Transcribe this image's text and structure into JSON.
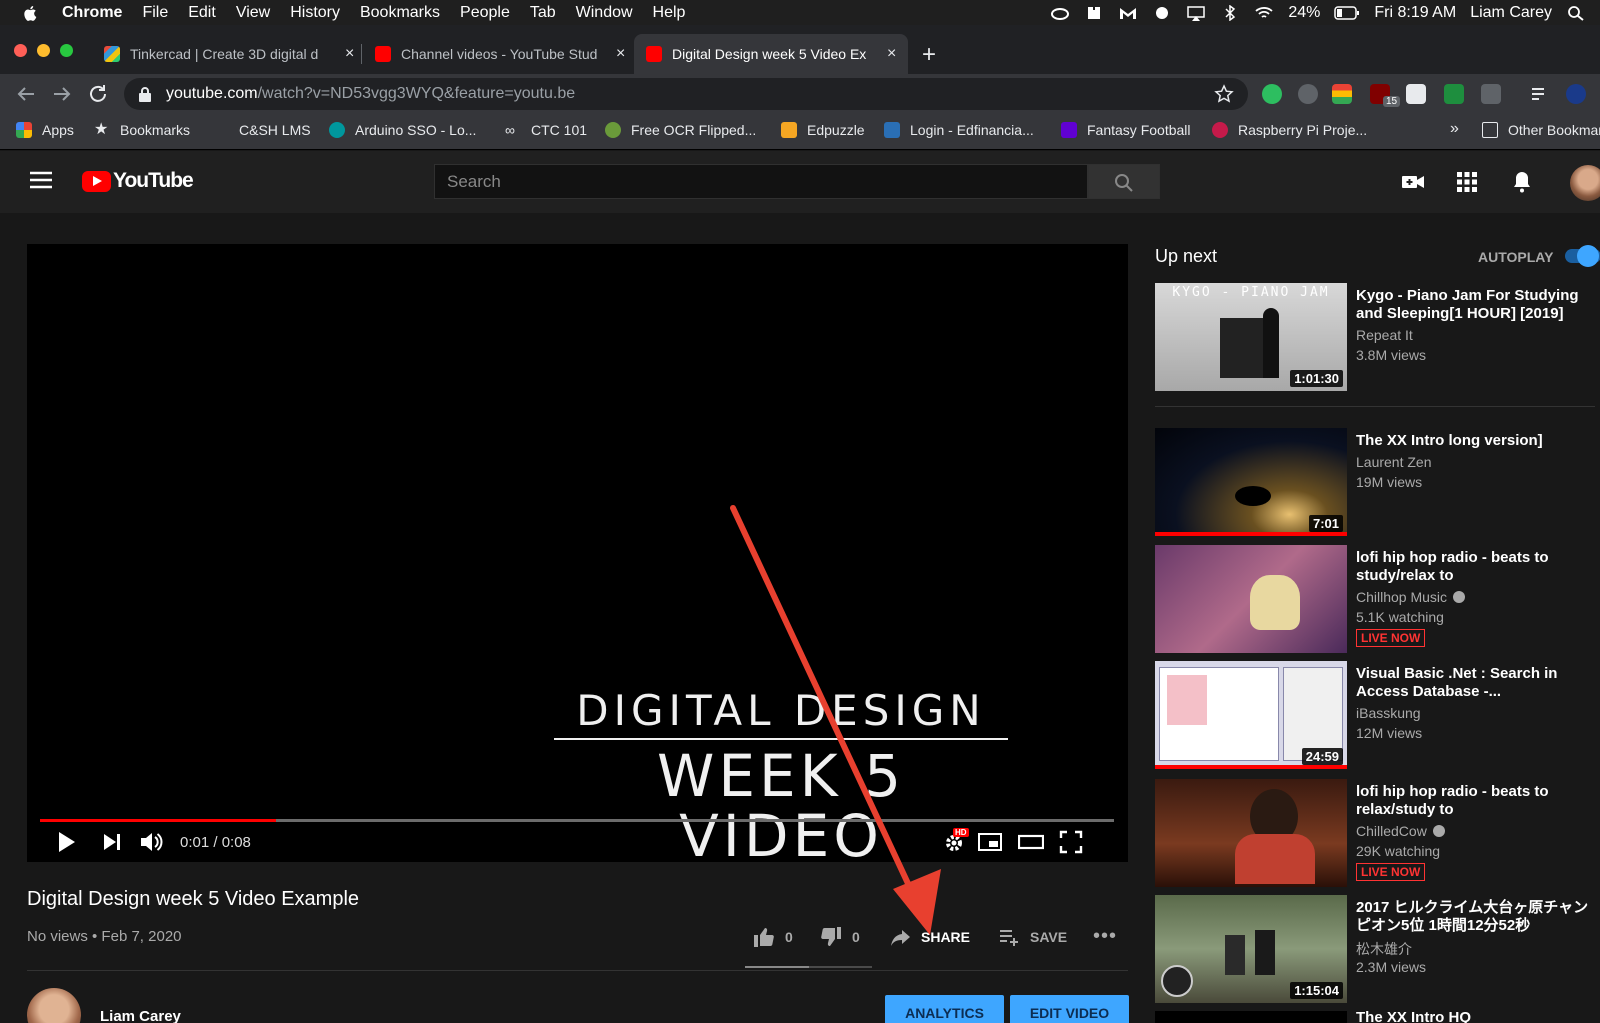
{
  "menubar": {
    "app": "Chrome",
    "items": [
      "File",
      "Edit",
      "View",
      "History",
      "Bookmarks",
      "People",
      "Tab",
      "Window",
      "Help"
    ],
    "battery": "24%",
    "clock": "Fri 8:19 AM",
    "user": "Liam Carey"
  },
  "tabs": [
    {
      "title": "Tinkercad | Create 3D digital d",
      "close": "×"
    },
    {
      "title": "Channel videos - YouTube Stud",
      "close": "×"
    },
    {
      "title": "Digital Design week 5 Video Ex",
      "close": "×"
    }
  ],
  "new_tab": "+",
  "omnibox": {
    "domain": "youtube.com",
    "path": "/watch?v=ND53vgg3WYQ&feature=youtu.be"
  },
  "extensions": {
    "badge": "15"
  },
  "bookmarks": [
    {
      "label": "Apps"
    },
    {
      "label": "Bookmarks"
    },
    {
      "label": "C&SH LMS"
    },
    {
      "label": "Arduino SSO - Lo..."
    },
    {
      "label": "CTC 101"
    },
    {
      "label": "Free OCR Flipped..."
    },
    {
      "label": "Edpuzzle"
    },
    {
      "label": "Login - Edfinancia..."
    },
    {
      "label": "Fantasy Football"
    },
    {
      "label": "Raspberry Pi Proje..."
    }
  ],
  "bookmarks_overflow": "»",
  "other_bookmarks": "Other Bookmarks",
  "youtube": {
    "logo_text": "YouTube",
    "search_placeholder": "Search"
  },
  "player": {
    "title_line1": "DIGITAL DESIGN",
    "title_line2": "WEEK 5  VIDEO",
    "time": "0:01 / 0:08",
    "progress": 0.22,
    "hd_badge": "HD"
  },
  "video": {
    "title": "Digital Design week 5 Video Example",
    "meta": "No views • Feb 7, 2020",
    "likes": "0",
    "dislikes": "0",
    "share_label": "SHARE",
    "save_label": "SAVE",
    "more": "•••"
  },
  "owner": {
    "name": "Liam Carey",
    "analytics_label": "ANALYTICS",
    "edit_label": "EDIT VIDEO"
  },
  "sidebar": {
    "up_next": "Up next",
    "autoplay": "AUTOPLAY",
    "autoplay_on": true,
    "items": [
      {
        "title": "Kygo - Piano Jam For Studying and Sleeping[1 HOUR] [2019]",
        "channel": "Repeat It",
        "views": "3.8M views",
        "duration": "1:01:30",
        "thumb_text": "KYGO - PIANO JAM"
      },
      {
        "title": "The XX Intro long version]",
        "channel": "Laurent Zen",
        "views": "19M views",
        "duration": "7:01",
        "watched": 1.0
      },
      {
        "title": "lofi hip hop radio - beats to study/relax to",
        "channel": "Chillhop Music",
        "views": "5.1K watching",
        "live": "LIVE NOW"
      },
      {
        "title": "Visual Basic .Net : Search in Access Database -...",
        "channel": "iBasskung",
        "views": "12M views",
        "duration": "24:59",
        "watched": 1.0
      },
      {
        "title": "lofi hip hop radio - beats to relax/study to",
        "channel": "ChilledCow",
        "views": "29K watching",
        "live": "LIVE NOW"
      },
      {
        "title": "2017 ヒルクライム大台ヶ原チャンピオン5位 1時間12分52秒",
        "channel": "松木雄介",
        "views": "2.3M views",
        "duration": "1:15:04"
      },
      {
        "title": "The XX Intro HQ"
      }
    ]
  },
  "colors": {
    "accent_red": "#ff0000",
    "annotation_arrow": "#e8402f",
    "action_blue": "#3ea6ff"
  }
}
